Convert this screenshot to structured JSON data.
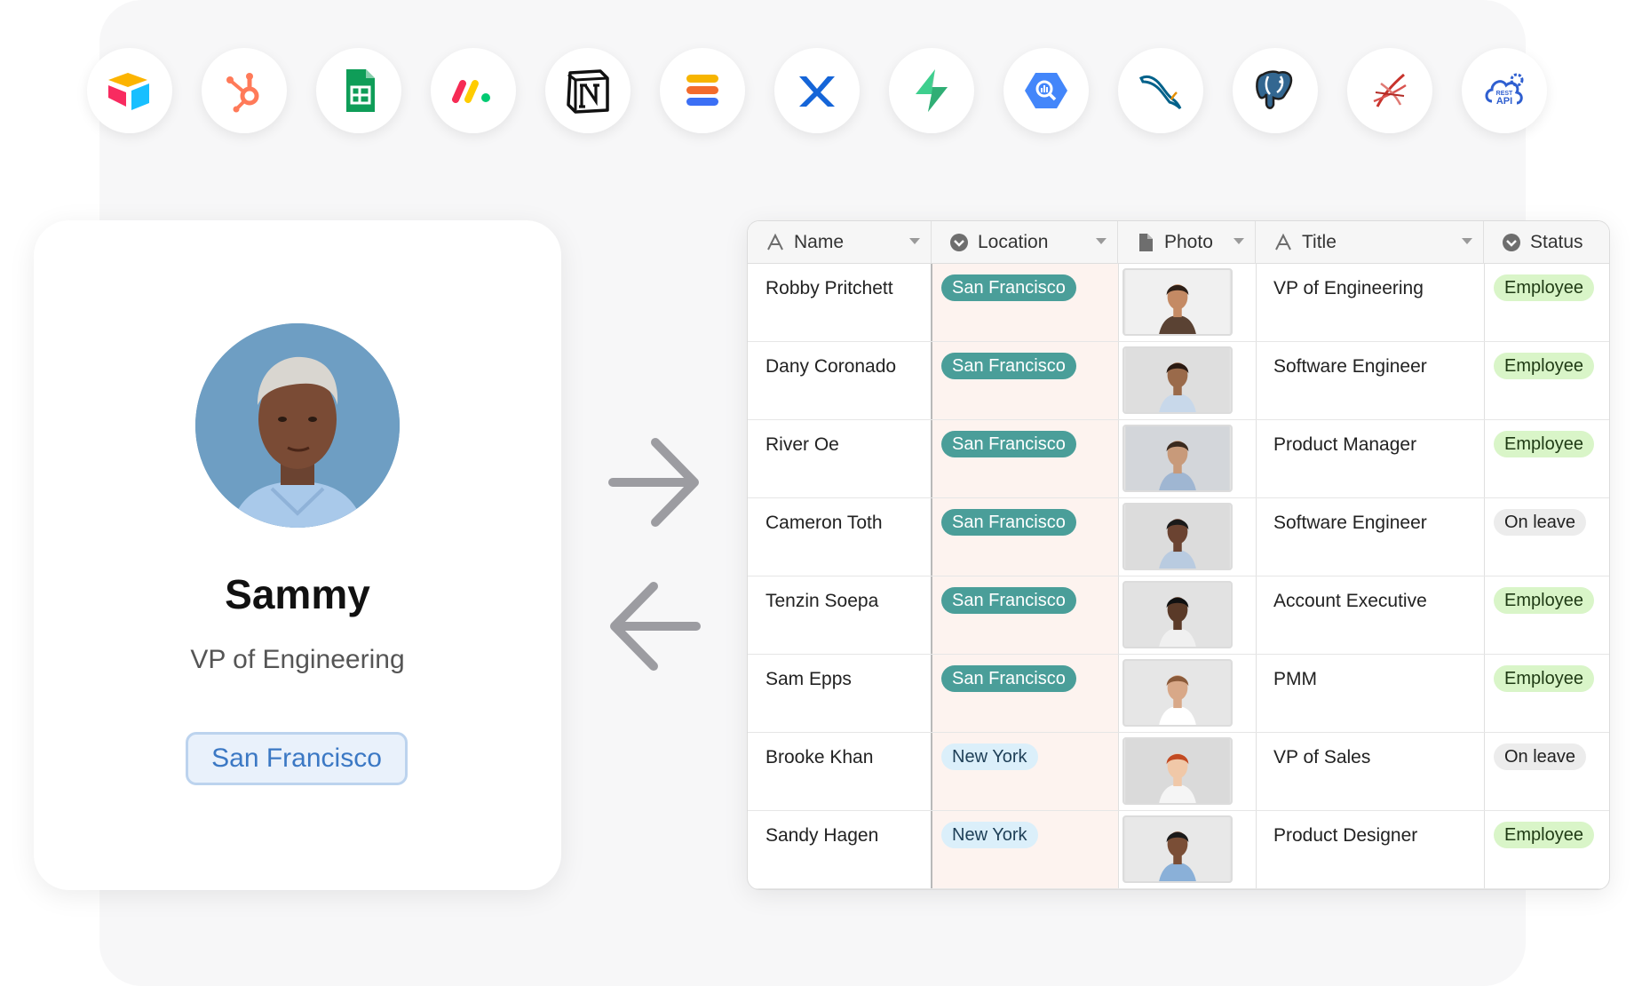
{
  "integrations": [
    {
      "name": "airtable-icon"
    },
    {
      "name": "hubspot-icon"
    },
    {
      "name": "google-sheets-icon"
    },
    {
      "name": "monday-icon"
    },
    {
      "name": "notion-icon"
    },
    {
      "name": "stacker-icon"
    },
    {
      "name": "xano-icon"
    },
    {
      "name": "supabase-icon"
    },
    {
      "name": "bigquery-icon"
    },
    {
      "name": "mysql-icon"
    },
    {
      "name": "postgresql-icon"
    },
    {
      "name": "sql-server-icon"
    },
    {
      "name": "rest-api-icon"
    }
  ],
  "rest_api_text": {
    "top": "REST",
    "bottom": "API"
  },
  "profile": {
    "name": "Sammy",
    "title": "VP of Engineering",
    "location": "San Francisco"
  },
  "table": {
    "columns": [
      {
        "label": "Name",
        "icon": "text-field-icon"
      },
      {
        "label": "Location",
        "icon": "single-select-icon"
      },
      {
        "label": "Photo",
        "icon": "attachment-icon"
      },
      {
        "label": "Title",
        "icon": "text-field-icon"
      },
      {
        "label": "Status",
        "icon": "single-select-icon"
      }
    ],
    "rows": [
      {
        "name": "Robby Pritchett",
        "location": "San Francisco",
        "title": "VP of Engineering",
        "status": "Employee"
      },
      {
        "name": "Dany Coronado",
        "location": "San Francisco",
        "title": "Software Engineer",
        "status": "Employee"
      },
      {
        "name": "River Oe",
        "location": "San Francisco",
        "title": "Product Manager",
        "status": "Employee"
      },
      {
        "name": "Cameron Toth",
        "location": "San Francisco",
        "title": "Software Engineer",
        "status": "On leave"
      },
      {
        "name": "Tenzin Soepa",
        "location": "San Francisco",
        "title": "Account Executive",
        "status": "Employee"
      },
      {
        "name": "Sam Epps",
        "location": "San Francisco",
        "title": "PMM",
        "status": "Employee"
      },
      {
        "name": "Brooke Khan",
        "location": "New York",
        "title": "VP of Sales",
        "status": "On leave"
      },
      {
        "name": "Sandy Hagen",
        "location": "New York",
        "title": "Product Designer",
        "status": "Employee"
      }
    ]
  },
  "colors": {
    "san_francisco_pill": "#4a9e99",
    "new_york_pill": "#dbeffa",
    "employee_pill": "#d9f5c8",
    "on_leave_pill": "#ececec",
    "location_column_bg": "#fdf3ef",
    "profile_location_border": "#bcd3ee"
  }
}
